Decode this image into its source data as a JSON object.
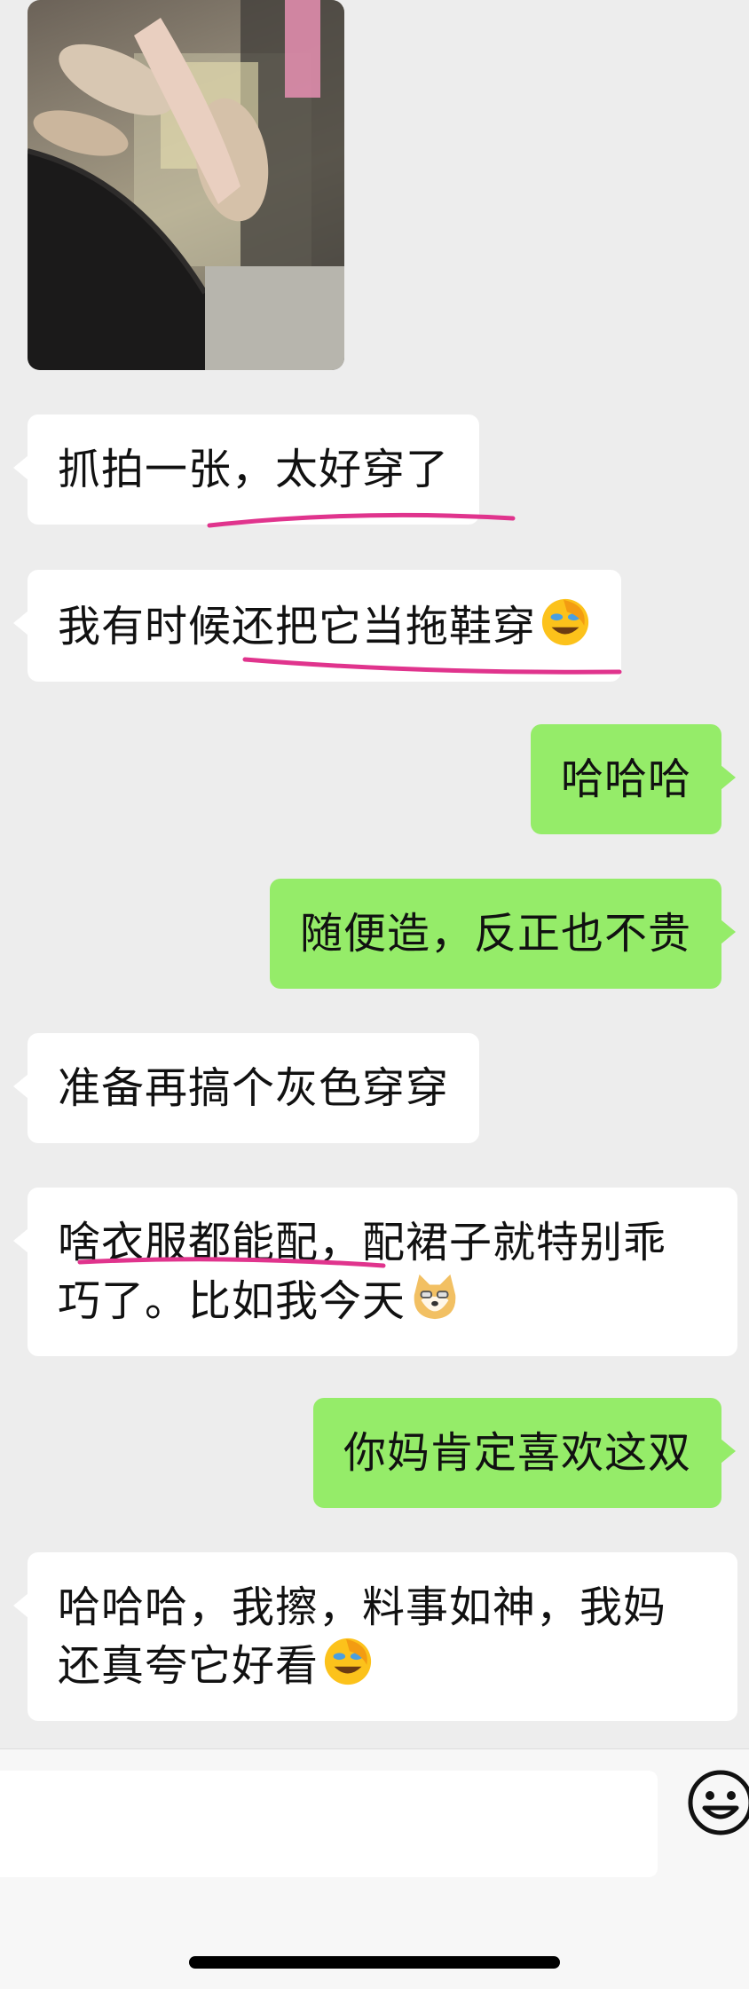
{
  "chat": {
    "messages": [
      {
        "side": "received",
        "type": "image",
        "alt": ""
      },
      {
        "side": "received",
        "type": "text",
        "text": "抓拍一张，太好穿了"
      },
      {
        "side": "received",
        "type": "text",
        "text": "我有时候还把它当拖鞋穿",
        "emoji": "facepalm-laugh-emoji"
      },
      {
        "side": "sent",
        "type": "text",
        "text": "哈哈哈"
      },
      {
        "side": "sent",
        "type": "text",
        "text": "随便造，反正也不贵"
      },
      {
        "side": "received",
        "type": "text",
        "text": "准备再搞个灰色穿穿"
      },
      {
        "side": "received",
        "type": "text",
        "line1": "啥衣服都能配，配裙子就特别乖",
        "line2": "巧了。比如我今天",
        "emoji": "shiba-doge-emoji"
      },
      {
        "side": "sent",
        "type": "text",
        "text": "你妈肯定喜欢这双"
      },
      {
        "side": "received",
        "type": "text",
        "line1": "哈哈哈，我擦，料事如神，我妈",
        "line2": "还真夸它好看",
        "emoji": "facepalm-laugh-emoji"
      }
    ],
    "highlight_color": "#e0348d"
  },
  "colors": {
    "background": "#ededed",
    "received_bubble": "#ffffff",
    "sent_bubble": "#95ec69"
  },
  "input": {
    "value": "",
    "emoji_button_icon": "smiley-icon"
  }
}
